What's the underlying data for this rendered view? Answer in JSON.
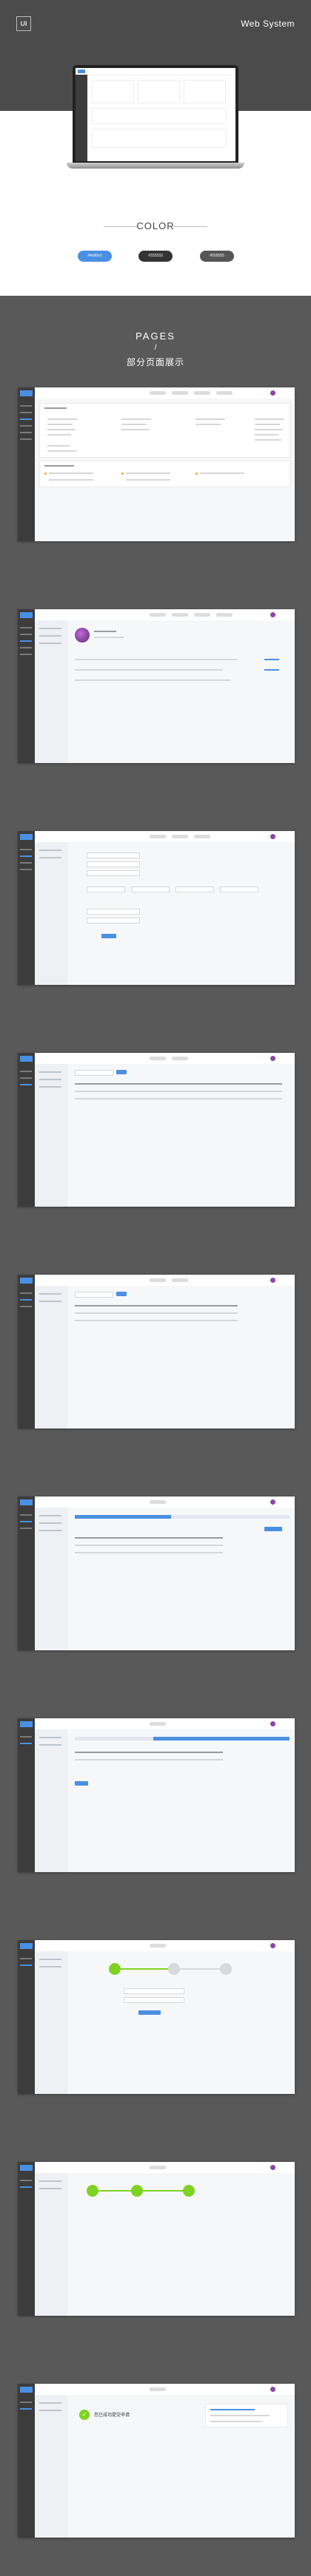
{
  "hero": {
    "badge": "UI",
    "title": "Web System"
  },
  "colors": {
    "title": "COLOR",
    "swatches": [
      {
        "label": "#4a90e2",
        "color": "#4a90e2"
      },
      {
        "label": "#333333",
        "color": "#333333"
      },
      {
        "label": "#555555",
        "color": "#555555"
      }
    ]
  },
  "pages": {
    "title": "PAGES",
    "slash": "/",
    "subtitle": "部分页面展示"
  },
  "success_page": {
    "message": "您已成功提交申请"
  },
  "icons": {
    "ui_badge": "square-outline-icon",
    "success": "check-circle-icon"
  }
}
